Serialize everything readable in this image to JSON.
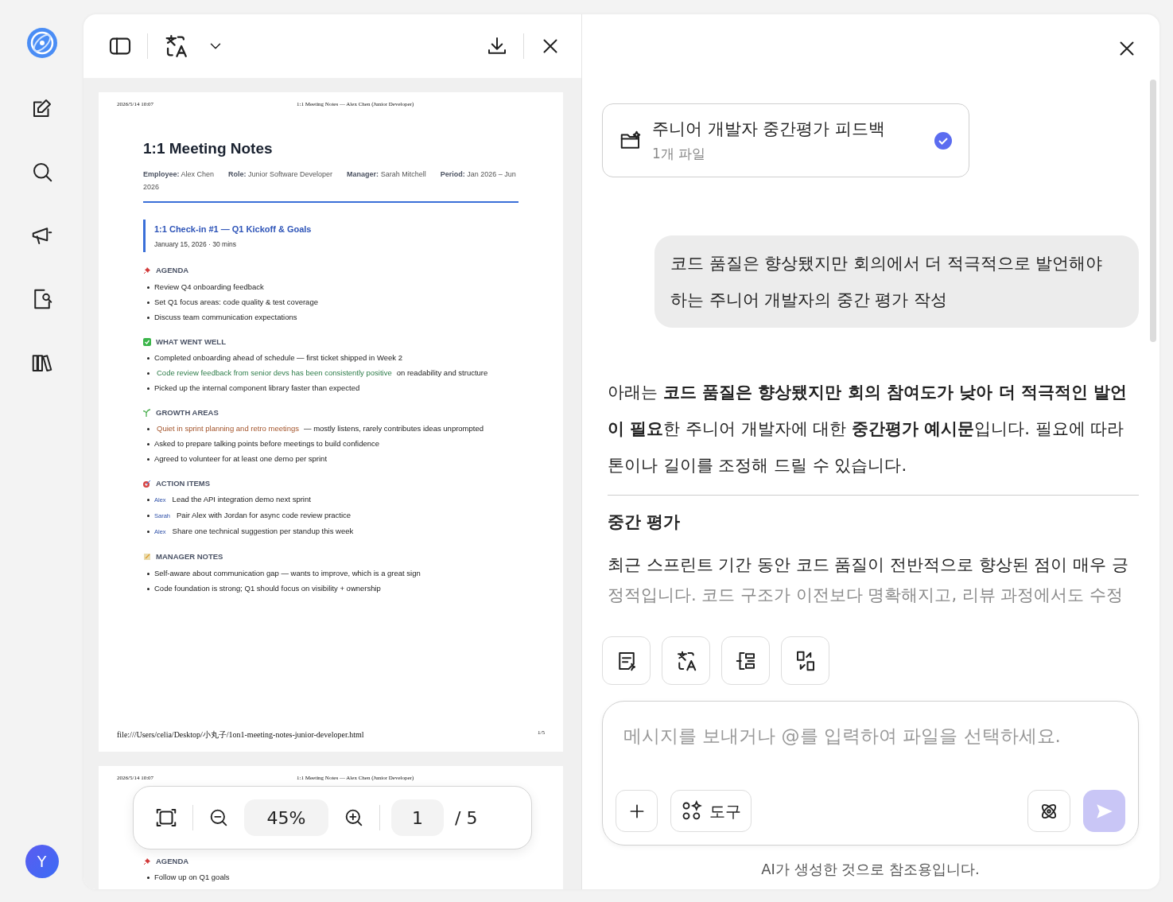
{
  "rail": {
    "avatar": "Y"
  },
  "pdf": {
    "pages": [
      {
        "header_date": "2026/5/14 10:07",
        "header_title": "1:1 Meeting Notes — Alex Chen (Junior Developer)",
        "title": "1:1 Meeting Notes",
        "meta": [
          {
            "label": "Employee:",
            "value": "Alex Chen"
          },
          {
            "label": "Role:",
            "value": "Junior Software Developer"
          },
          {
            "label": "Manager:",
            "value": "Sarah Mitchell"
          },
          {
            "label": "Period:",
            "value": "Jan 2026 – Jun 2026"
          }
        ],
        "checkin": {
          "title": "1:1 Check-in #1 — Q1 Kickoff & Goals",
          "subtitle": "January 15, 2026 · 30 mins"
        },
        "sections": [
          {
            "heading": "AGENDA",
            "items": [
              {
                "kind": "plain",
                "text": "Review Q4 onboarding feedback"
              },
              {
                "kind": "plain",
                "text": "Set Q1 focus areas: code quality & test coverage"
              },
              {
                "kind": "plain",
                "text": "Discuss team communication expectations"
              }
            ]
          },
          {
            "heading": "WHAT WENT WELL",
            "items": [
              {
                "kind": "plain",
                "text": "Completed onboarding ahead of schedule — first ticket shipped in Week 2"
              },
              {
                "kind": "positive",
                "highlight": "Code review feedback from senior devs has been consistently positive",
                "text": "on readability and structure"
              },
              {
                "kind": "plain",
                "text": "Picked up the internal component library faster than expected"
              }
            ]
          },
          {
            "heading": "GROWTH AREAS",
            "items": [
              {
                "kind": "concern",
                "highlight": "Quiet in sprint planning and retro meetings",
                "text": "— mostly listens, rarely contributes ideas unprompted"
              },
              {
                "kind": "plain",
                "text": "Asked to prepare talking points before meetings to build confidence"
              },
              {
                "kind": "plain",
                "text": "Agreed to volunteer for at least one demo per sprint"
              }
            ]
          },
          {
            "heading": "ACTION ITEMS",
            "items": [
              {
                "kind": "action",
                "owner": "Alex",
                "text": "Lead the API integration demo next sprint"
              },
              {
                "kind": "action",
                "owner": "Sarah",
                "text": "Pair Alex with Jordan for async code review practice"
              },
              {
                "kind": "action",
                "owner": "Alex",
                "text": "Share one technical suggestion per standup this week"
              }
            ]
          },
          {
            "heading": "MANAGER NOTES",
            "items": [
              {
                "kind": "plain",
                "text": "Self-aware about communication gap — wants to improve, which is a great sign"
              },
              {
                "kind": "plain",
                "text": "Code foundation is strong; Q1 should focus on visibility + ownership"
              }
            ]
          }
        ],
        "footer_path": "file:///Users/celia/Desktop/小丸子/1on1-meeting-notes-junior-developer.html",
        "footer_page": "1/5"
      },
      {
        "header_date": "2026/5/14 10:07",
        "header_title": "1:1 Meeting Notes — Alex Chen (Junior Developer)",
        "sections": [
          {
            "heading": "AGENDA",
            "items": [
              {
                "kind": "plain",
                "text": "Follow up on Q1 goals"
              }
            ]
          }
        ]
      }
    ],
    "zoom": "45%",
    "page": "1",
    "page_total": "/ 5"
  },
  "chat": {
    "file_card": {
      "title": "주니어 개발자 중간평가 피드백",
      "subtitle": "1개 파일",
      "checked": true
    },
    "user_message": "코드 품질은 향상됐지만 회의에서 더 적극적으로 발언해야 하는 주니어 개발자의 중간 평가 작성",
    "answer_intro": "아래는 **코드 품질은 향상됐지만 회의 참여도가 낮아 더 적극적인 발언이 필요**한 주니어 개발자에 대한 **중간평가 예시문**입니다. 필요에 따라 톤이나 길이를 조정해 드릴 수 있습니다.",
    "heading": "중간 평가",
    "paragraph": "최근 스프린트 기간 동안 코드 품질이 전반적으로 향상된 점이 매우 긍",
    "faded_line": "정적입니다. 코드 구조가 이전보다 명확해지고, 리뷰 과정에서도 수정",
    "input": {
      "placeholder": "메시지를 보내거나 @를 입력하여 파일을 선택하세요."
    },
    "tools_label": "도구",
    "send_disabled": true,
    "disclaimer": "AI가 생성한 것으로 참조용입니다."
  }
}
